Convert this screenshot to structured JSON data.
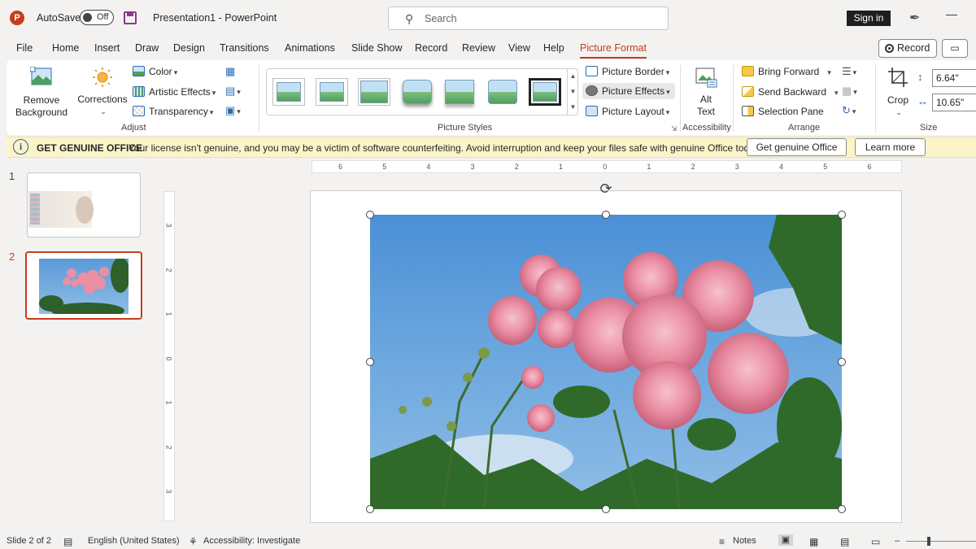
{
  "titlebar": {
    "app_logo": "P",
    "autosave_label": "AutoSave",
    "autosave_state": "Off",
    "doc_title": "Presentation1  -  PowerPoint",
    "search_placeholder": "Search",
    "signin_label": "Sign in"
  },
  "menu": {
    "tabs": [
      "File",
      "Home",
      "Insert",
      "Draw",
      "Design",
      "Transitions",
      "Animations",
      "Slide Show",
      "Record",
      "Review",
      "View",
      "Help",
      "Picture Format"
    ],
    "active_tab": "Picture Format",
    "record_label": "Record"
  },
  "ribbon": {
    "adjust": {
      "remove_background": [
        "Remove",
        "Background"
      ],
      "corrections": "Corrections",
      "color": "Color",
      "artistic_effects": "Artistic Effects",
      "transparency": "Transparency",
      "group_label": "Adjust"
    },
    "picture_styles": {
      "group_label": "Picture Styles",
      "picture_border": "Picture Border",
      "picture_effects": "Picture Effects",
      "picture_layout": "Picture Layout"
    },
    "accessibility": {
      "alt_text": [
        "Alt",
        "Text"
      ],
      "group_label": "Accessibility"
    },
    "arrange": {
      "bring_forward": "Bring Forward",
      "send_backward": "Send Backward",
      "selection_pane": "Selection Pane",
      "group_label": "Arrange"
    },
    "size": {
      "crop": "Crop",
      "height": "6.64\"",
      "width": "10.65\"",
      "group_label": "Size"
    }
  },
  "infobar": {
    "title": "GET GENUINE OFFICE",
    "message": "Your license isn't genuine, and you may be a victim of software counterfeiting. Avoid interruption and keep your files safe with genuine Office today.",
    "primary_button": "Get genuine Office",
    "secondary_button": "Learn more"
  },
  "slides": {
    "numbers": [
      "1",
      "2"
    ],
    "active": "2"
  },
  "ruler": {
    "h_ticks": [
      "6",
      "5",
      "4",
      "3",
      "2",
      "1",
      "0",
      "1",
      "2",
      "3",
      "4",
      "5",
      "6"
    ],
    "v_ticks": [
      "3",
      "2",
      "1",
      "0",
      "1",
      "2",
      "3"
    ]
  },
  "statusbar": {
    "slide_info": "Slide 2 of 2",
    "language": "English (United States)",
    "accessibility": "Accessibility: Investigate",
    "notes": "Notes"
  },
  "colors": {
    "accent": "#c43e1c",
    "infobar_bg": "#fcf4c9",
    "ribbon_bg": "#ffffff",
    "app_bg": "#f3f2f1"
  }
}
